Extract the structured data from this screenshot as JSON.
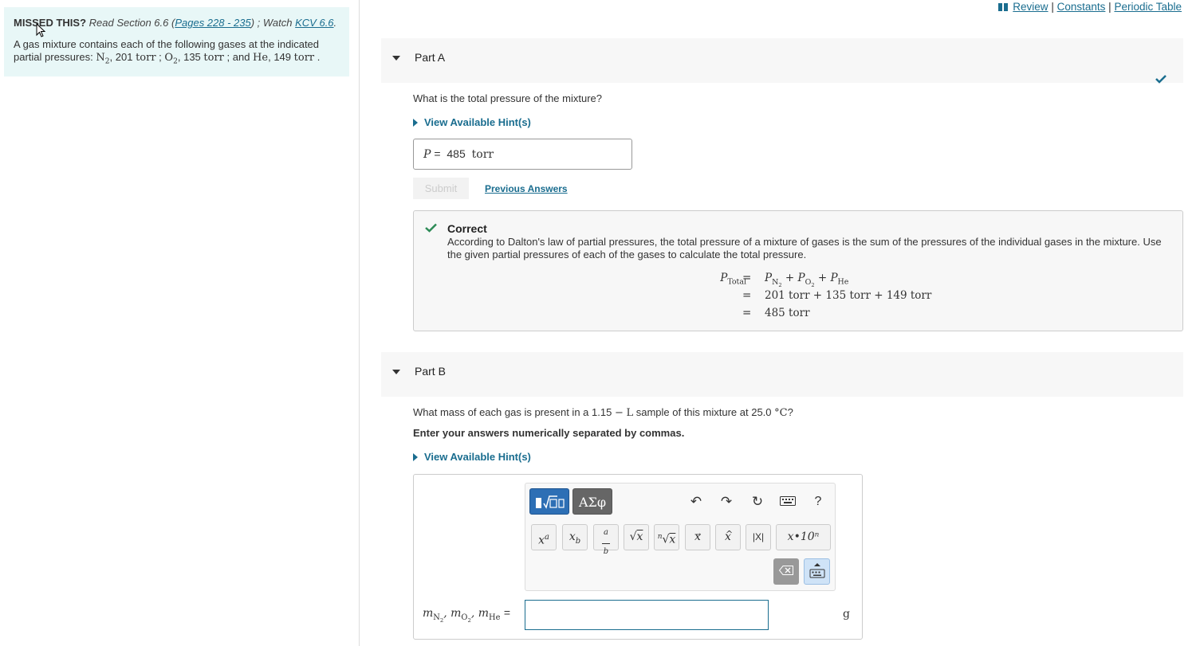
{
  "top_links": {
    "review": "Review",
    "sep1": "|",
    "constants": "Constants",
    "sep2": "|",
    "periodic_table": "Periodic Table"
  },
  "intro": {
    "missed_label": "MISSED THIS?",
    "read_text": "Read Section 6.6 (",
    "pages_link": "Pages 228 - 235",
    "watch_text": ") ; Watch ",
    "kcv_link": "KCV 6.6",
    "period": ".",
    "problem_prefix": "A gas mixture contains each of the following gases at the indicated partial pressures: ",
    "n2_value": "201",
    "o2_value": "135",
    "he_value": "149",
    "unit": "torr"
  },
  "part_a": {
    "title": "Part A",
    "question": "What is the total pressure of the mixture?",
    "hint_label": "View Available Hint(s)",
    "answer_var": "P",
    "answer_eq": "=",
    "answer_value": "485",
    "answer_unit": "torr",
    "submit_label": "Submit",
    "previous_answers_label": "Previous Answers",
    "feedback_title": "Correct",
    "feedback_text": "According to Dalton's law of partial pressures, the total pressure of a mixture of gases is the sum of the pressures of the individual gases in the mixture. Use the given partial pressures of each of the gases to calculate the total pressure.",
    "eq_row2": "201 torr + 135 torr + 149 torr",
    "eq_row3": "485 torr"
  },
  "part_b": {
    "title": "Part B",
    "question_prefix": "What mass of each gas is present in a 1.15",
    "question_volume_unit": "L",
    "question_mid": " sample of this mixture at 25.0",
    "question_temp_unit": "°C",
    "question_end": "?",
    "instruction": "Enter your answers numerically separated by commas.",
    "hint_label": "View Available Hint(s)",
    "greek_button": "ΑΣφ",
    "help_button": "?",
    "sci_button": "x•10ⁿ",
    "abs_button": "|X|",
    "answer_unit": "g",
    "answer_value": ""
  },
  "colors": {
    "accent": "#1a6d8f",
    "correct": "#2e8b57",
    "intro_bg": "#e8f7f7",
    "toolbar_blue": "#2d6fb5",
    "toolbar_gray": "#666666"
  }
}
